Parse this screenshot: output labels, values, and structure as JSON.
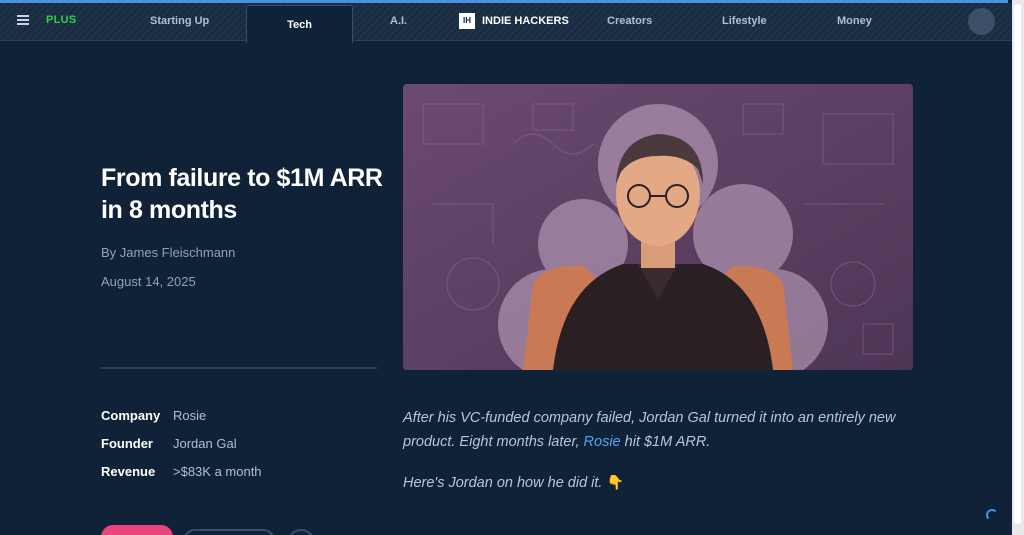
{
  "navbar": {
    "plus_label": "PLUS",
    "links": [
      "Starting Up",
      "Tech",
      "A.I.",
      "Creators",
      "Lifestyle",
      "Money"
    ],
    "active_tab": "Tech",
    "brand_logo": "IH",
    "brand_name": "INDIE HACKERS"
  },
  "article": {
    "title": "From failure to $1M ARR in 8 months",
    "byline": "By James Fleischmann",
    "date": "August 14, 2025",
    "meta": [
      {
        "label": "Company",
        "value": "Rosie"
      },
      {
        "label": "Founder",
        "value": "Jordan Gal"
      },
      {
        "label": "Revenue",
        "value": ">$83K a month"
      }
    ],
    "intro_before_link": "After his VC-funded company failed, Jordan Gal turned it into an entirely new product. Eight months later, ",
    "intro_link": "Rosie",
    "intro_after_link": " hit $1M ARR.",
    "intro2_text": "Here's Jordan on how he did it.",
    "intro2_emoji": "👇"
  },
  "colors": {
    "background": "#0f2238",
    "accent": "#4a90e2",
    "plus": "#2bd24a",
    "link": "#5aa2ef",
    "cta": "#e9457c"
  },
  "icons": {
    "menu": "hamburger-icon",
    "loading": "spinner-icon"
  }
}
